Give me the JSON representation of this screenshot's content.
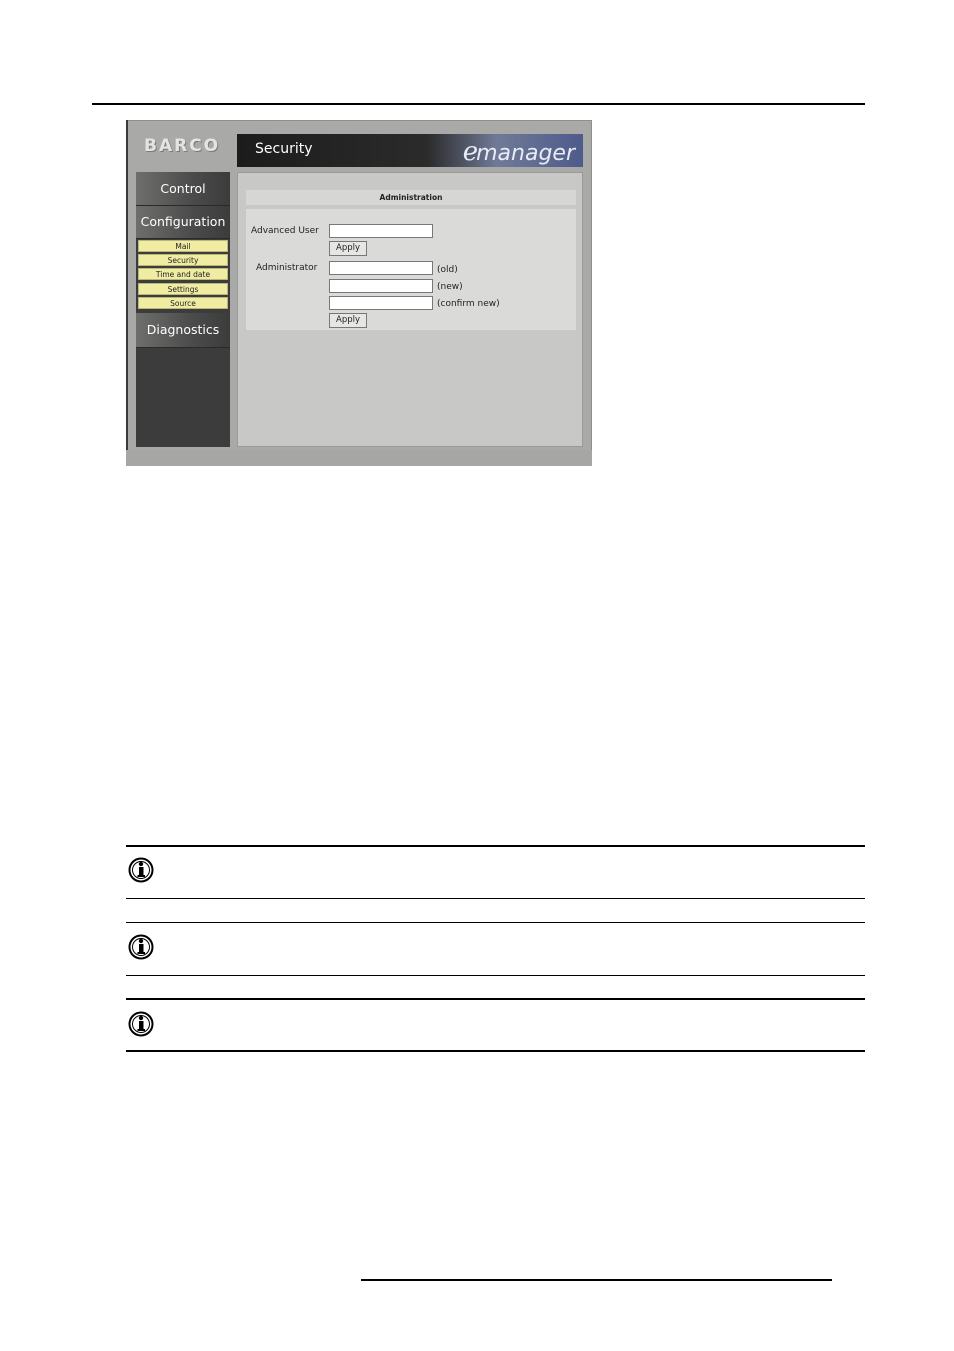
{
  "app": {
    "logo": "BARCO",
    "header_title": "Security",
    "brand_e": "e",
    "brand_rest": "manager"
  },
  "sidebar": {
    "control": "Control",
    "configuration": "Configuration",
    "sub_items": [
      "Mail",
      "Security",
      "Time and date",
      "Settings",
      "Source"
    ],
    "diagnostics": "Diagnostics"
  },
  "main": {
    "section_title": "Administration",
    "advanced_user_label": "Advanced User",
    "administrator_label": "Administrator",
    "apply_label": "Apply",
    "old_hint": "(old)",
    "new_hint": "(new)",
    "confirm_hint": "(confirm new)"
  },
  "notes": {
    "icon": "info-icon"
  }
}
